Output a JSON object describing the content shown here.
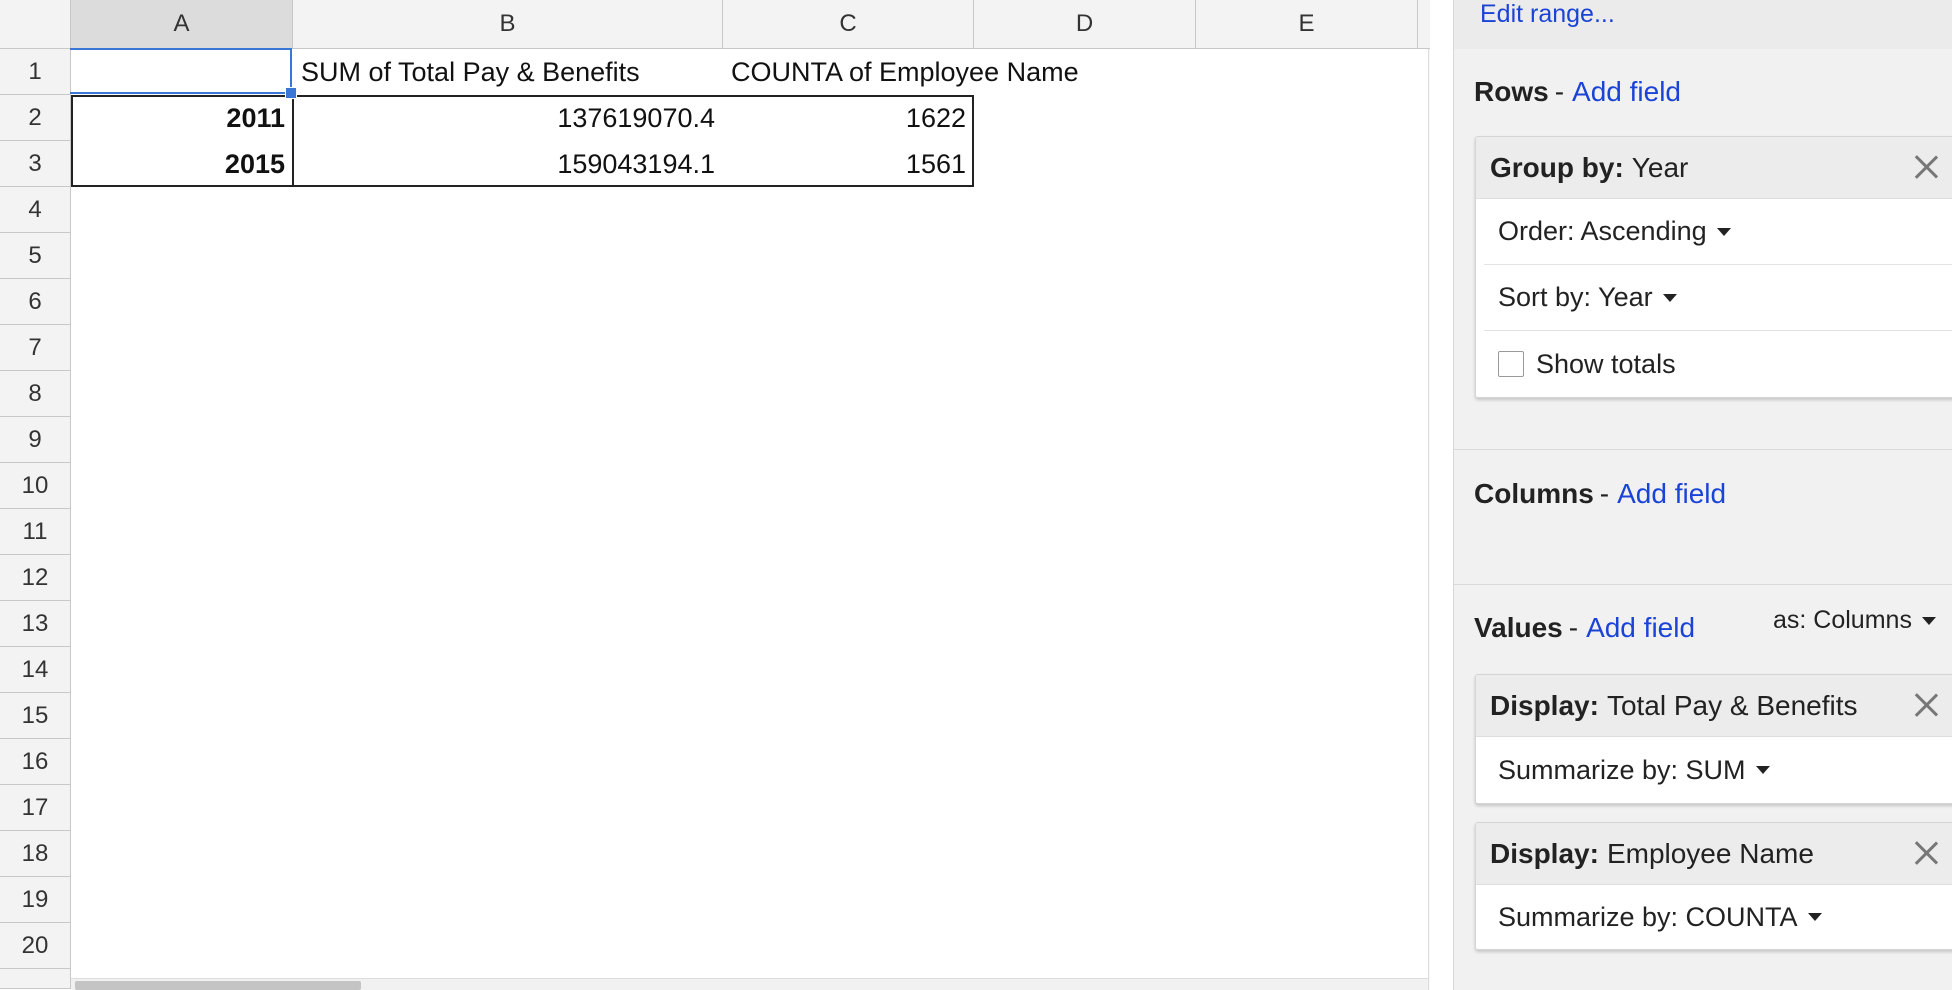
{
  "sheet": {
    "columns": [
      "A",
      "B",
      "C",
      "D",
      "E"
    ],
    "rows": [
      "1",
      "2",
      "3",
      "4",
      "5",
      "6",
      "7",
      "8",
      "9",
      "10",
      "11",
      "12",
      "13",
      "14",
      "15",
      "16",
      "17",
      "18",
      "19",
      "20"
    ],
    "header_row": [
      "",
      "SUM of Total Pay & Benefits",
      "COUNTA of Employee Name"
    ],
    "data_rows": [
      [
        "2011",
        "137619070.4",
        "1622"
      ],
      [
        "2015",
        "159043194.1",
        "1561"
      ]
    ],
    "selected_cell": "A1"
  },
  "panel": {
    "edit_range": "Edit range...",
    "add_field": "Add field",
    "dash": "-",
    "rows": {
      "title": "Rows",
      "group_card": {
        "label": "Group by:",
        "field": "Year",
        "order": "Order: Ascending",
        "sort": "Sort by: Year",
        "show_totals": "Show totals",
        "show_totals_checked": false
      }
    },
    "columns": {
      "title": "Columns"
    },
    "values": {
      "title": "Values",
      "as": "as: Columns",
      "cards": [
        {
          "label": "Display:",
          "field": "Total Pay & Benefits",
          "summarize": "Summarize by: SUM"
        },
        {
          "label": "Display:",
          "field": "Employee Name",
          "summarize": "Summarize by: COUNTA"
        }
      ]
    }
  }
}
